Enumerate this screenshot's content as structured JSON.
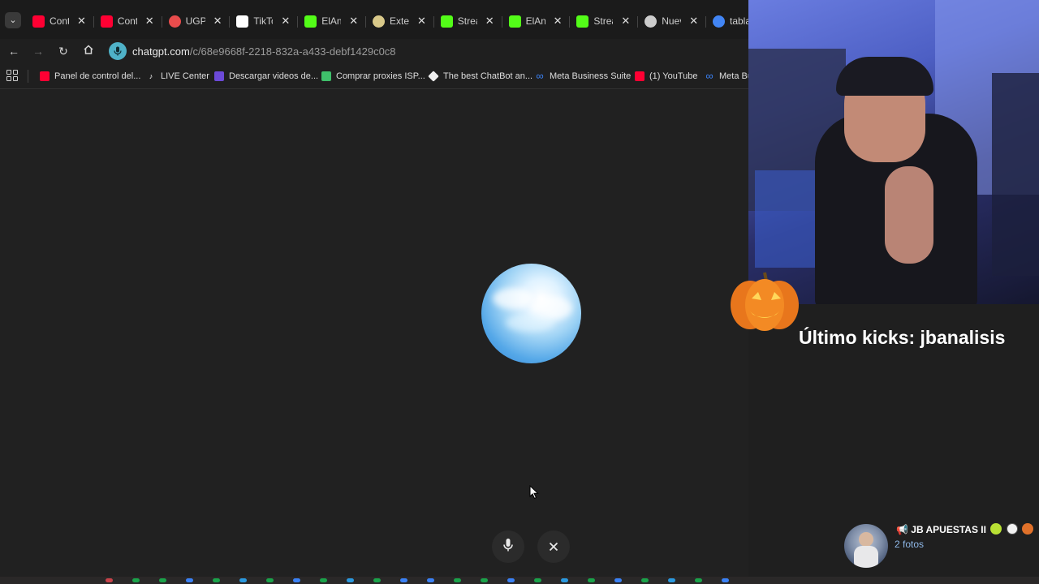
{
  "browser": {
    "tabs": [
      {
        "label": "Cont",
        "icon": "youtube-icon",
        "color": "#ff0033"
      },
      {
        "label": "Cont",
        "icon": "youtube-icon",
        "color": "#ff0033"
      },
      {
        "label": "UGPl",
        "icon": "ugp-icon",
        "color": "#e84c4c"
      },
      {
        "label": "TikTo",
        "icon": "tiktok-icon",
        "color": "#ffffff"
      },
      {
        "label": "ElAnc",
        "icon": "kick-clover-icon",
        "color": "#53fc18"
      },
      {
        "label": "Exter",
        "icon": "extension-icon",
        "color": "#d9c98a"
      },
      {
        "label": "Strea",
        "icon": "kick-icon",
        "color": "#53fc18"
      },
      {
        "label": "ElAnc",
        "icon": "kick-clover-icon",
        "color": "#53fc18"
      },
      {
        "label": "Strea",
        "icon": "kick-icon",
        "color": "#53fc18"
      },
      {
        "label": "Nuev",
        "icon": "chrome-icon",
        "color": "#cccccc"
      },
      {
        "label": "tabla",
        "icon": "google-icon",
        "color": "#4285f4"
      }
    ],
    "url_host": "chatgpt.com",
    "url_path": "/c/68e9668f-2218-832a-a433-debf1429c0c8",
    "bookmarks": [
      {
        "label": "Panel de control del...",
        "icon": "youtube-icon",
        "color": "#ff0033"
      },
      {
        "label": "LIVE Center",
        "icon": "tiktok-icon",
        "color": "#ffffff"
      },
      {
        "label": "Descargar videos de...",
        "icon": "download-icon",
        "color": "#6c4ad8"
      },
      {
        "label": "Comprar proxies ISP...",
        "icon": "proxy-icon",
        "color": "#3fbf6a"
      },
      {
        "label": "The best ChatBot an...",
        "icon": "chatbot-icon",
        "color": "#eeeeee"
      },
      {
        "label": "Meta Business Suite",
        "icon": "meta-icon",
        "color": "#3b82f6"
      },
      {
        "label": "(1) YouTube",
        "icon": "youtube-icon",
        "color": "#ff0033"
      },
      {
        "label": "Meta Bu",
        "icon": "meta-icon",
        "color": "#3b82f6"
      }
    ]
  },
  "stream_overlay": {
    "last_kicks": "Último kicks: jbanalisis",
    "channel_name": "📢 JB APUESTAS II",
    "channel_sub": "2 fotos"
  },
  "colors": {
    "background": "#212121",
    "orb_blue": "#55a8e8",
    "kick_green": "#53fc18"
  }
}
